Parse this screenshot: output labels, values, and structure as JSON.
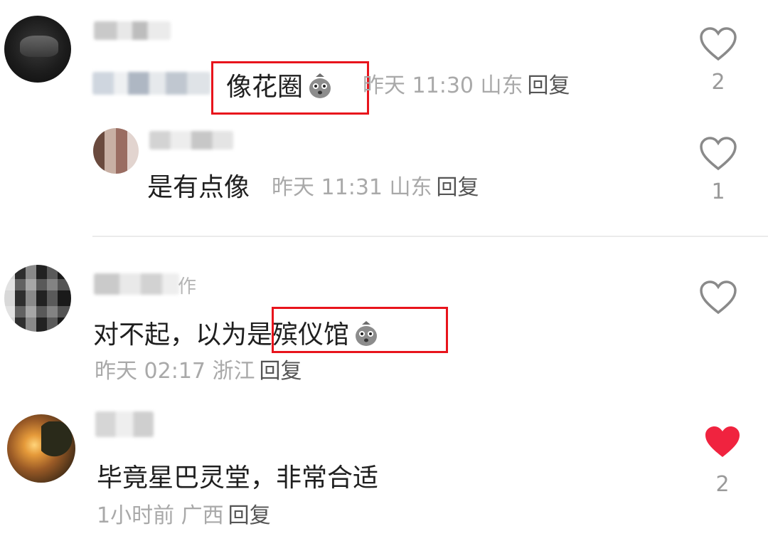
{
  "comments": [
    {
      "username_visible": "",
      "text": "像花圈",
      "has_emoji": true,
      "emoji_icon": "money-bag-face-emoji",
      "time": "昨天 11:30",
      "location": "山东",
      "reply_label": "回复",
      "likes": "2",
      "liked": false,
      "reply": {
        "text": "是有点像",
        "time": "昨天 11:31",
        "location": "山东",
        "reply_label": "回复",
        "likes": "1",
        "liked": false
      }
    },
    {
      "username_visible": "作",
      "text": "对不起，以为是殡仪馆",
      "has_emoji": true,
      "emoji_icon": "money-bag-face-emoji",
      "time": "昨天 02:17",
      "location": "浙江",
      "reply_label": "回复",
      "likes": "",
      "liked": false
    },
    {
      "username_visible": "",
      "text": "毕竟星巴灵堂，非常合适",
      "time": "1小时前",
      "location": "广西",
      "reply_label": "回复",
      "likes": "2",
      "liked": true
    }
  ],
  "colors": {
    "highlight": "#e8141c",
    "liked_heart": "#f0233f",
    "meta_text": "#a9a9a9"
  }
}
